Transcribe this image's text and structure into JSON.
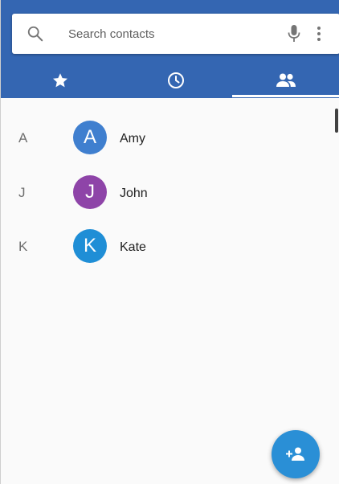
{
  "search": {
    "placeholder": "Search contacts"
  },
  "tabs": [
    {
      "name": "Favorites",
      "icon": "star-icon"
    },
    {
      "name": "Recents",
      "icon": "clock-icon"
    },
    {
      "name": "Contacts",
      "icon": "people-icon",
      "selected": true
    }
  ],
  "contacts": [
    {
      "letter": "A",
      "initial": "A",
      "name": "Amy",
      "color": "#3f7fcf"
    },
    {
      "letter": "J",
      "initial": "J",
      "name": "John",
      "color": "#8e44a8"
    },
    {
      "letter": "K",
      "initial": "K",
      "name": "Kate",
      "color": "#1f8ed6"
    }
  ],
  "fab": {
    "icon": "add-contact-icon"
  },
  "colors": {
    "header": "#3466b2",
    "fab": "#2a8fd6",
    "background": "#fafafa"
  }
}
